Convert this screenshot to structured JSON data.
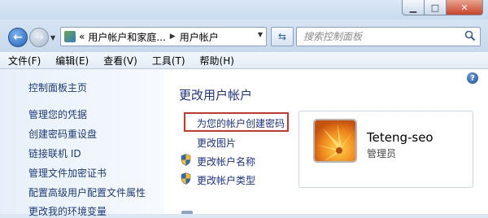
{
  "address_bar": {
    "crumbs": [
      "«",
      "用户帐户和家庭...",
      "用户帐户"
    ]
  },
  "search": {
    "placeholder": "搜索控制面板"
  },
  "menu": [
    "文件(F)",
    "编辑(E)",
    "查看(V)",
    "工具(T)",
    "帮助(H)"
  ],
  "sidebar": {
    "items": [
      "控制面板主页",
      "管理您的凭据",
      "创建密码重设盘",
      "链接联机 ID",
      "管理文件加密证书",
      "配置高级用户配置文件属性",
      "更改我的环境变量"
    ]
  },
  "main": {
    "title": "更改用户帐户",
    "links": [
      "为您的帐户创建密码",
      "更改图片",
      "更改帐户名称",
      "更改帐户类型"
    ]
  },
  "account": {
    "name": "Teteng-seo",
    "role": "管理员"
  },
  "colors": {
    "link": "#1e3287",
    "highlight_border": "#d4332a",
    "sidebar_bg": "#e7f0fa"
  }
}
